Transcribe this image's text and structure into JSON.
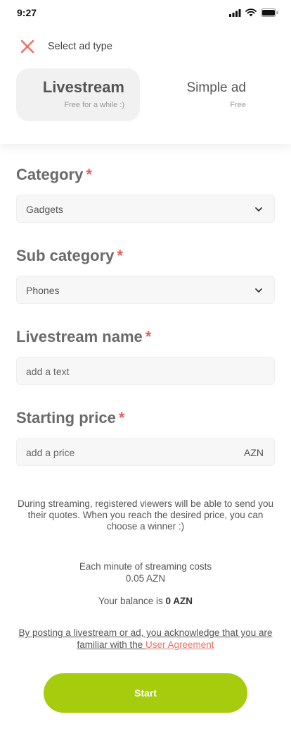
{
  "status_bar": {
    "time": "9:27"
  },
  "header": {
    "title": "Select ad type",
    "close_icon": "close-icon"
  },
  "ad_types": [
    {
      "title": "Livestream",
      "subtitle": "Free for a while :)",
      "active": true
    },
    {
      "title": "Simple ad",
      "subtitle": "Free",
      "active": false
    }
  ],
  "form": {
    "category": {
      "label": "Category",
      "required_mark": "*",
      "value": "Gadgets"
    },
    "sub_category": {
      "label": "Sub category",
      "required_mark": "*",
      "value": "Phones"
    },
    "livestream_name": {
      "label": "Livestream name",
      "required_mark": "*",
      "placeholder": "add a text"
    },
    "starting_price": {
      "label": "Starting price",
      "required_mark": "*",
      "placeholder": "add a price",
      "currency": "AZN"
    }
  },
  "info": {
    "streaming_note": "During streaming, registered viewers will be able to send you their quotes. When you reach the desired price, you can choose a winner :)",
    "cost_line1": "Each minute of streaming costs",
    "cost_line2": "0.05 AZN",
    "balance_label": "Your balance is",
    "balance_value": "0 AZN"
  },
  "agreement": {
    "text": "By posting a livestream or ad, you acknowledge that you are familiar with the",
    "link": "User Agreement"
  },
  "start_button": {
    "label": "Start"
  },
  "colors": {
    "accent": "#a6cc0d",
    "required": "#e85b5b",
    "close": "#e8746a",
    "link": "#e8746a"
  }
}
